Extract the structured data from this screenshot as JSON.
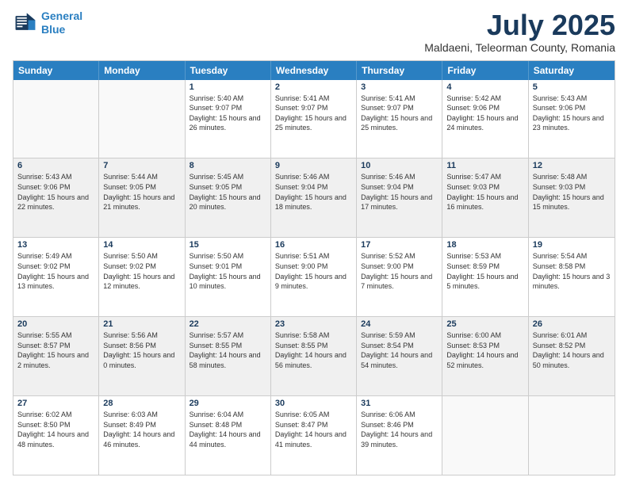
{
  "header": {
    "logo_line1": "General",
    "logo_line2": "Blue",
    "title": "July 2025",
    "subtitle": "Maldaeni, Teleorman County, Romania"
  },
  "days_of_week": [
    "Sunday",
    "Monday",
    "Tuesday",
    "Wednesday",
    "Thursday",
    "Friday",
    "Saturday"
  ],
  "weeks": [
    [
      {
        "day": "",
        "empty": true
      },
      {
        "day": "",
        "empty": true
      },
      {
        "day": "1",
        "sunrise": "5:40 AM",
        "sunset": "9:07 PM",
        "daylight": "15 hours and 26 minutes."
      },
      {
        "day": "2",
        "sunrise": "5:41 AM",
        "sunset": "9:07 PM",
        "daylight": "15 hours and 25 minutes."
      },
      {
        "day": "3",
        "sunrise": "5:41 AM",
        "sunset": "9:07 PM",
        "daylight": "15 hours and 25 minutes."
      },
      {
        "day": "4",
        "sunrise": "5:42 AM",
        "sunset": "9:06 PM",
        "daylight": "15 hours and 24 minutes."
      },
      {
        "day": "5",
        "sunrise": "5:43 AM",
        "sunset": "9:06 PM",
        "daylight": "15 hours and 23 minutes."
      }
    ],
    [
      {
        "day": "6",
        "sunrise": "5:43 AM",
        "sunset": "9:06 PM",
        "daylight": "15 hours and 22 minutes.",
        "shaded": true
      },
      {
        "day": "7",
        "sunrise": "5:44 AM",
        "sunset": "9:05 PM",
        "daylight": "15 hours and 21 minutes.",
        "shaded": true
      },
      {
        "day": "8",
        "sunrise": "5:45 AM",
        "sunset": "9:05 PM",
        "daylight": "15 hours and 20 minutes.",
        "shaded": true
      },
      {
        "day": "9",
        "sunrise": "5:46 AM",
        "sunset": "9:04 PM",
        "daylight": "15 hours and 18 minutes.",
        "shaded": true
      },
      {
        "day": "10",
        "sunrise": "5:46 AM",
        "sunset": "9:04 PM",
        "daylight": "15 hours and 17 minutes.",
        "shaded": true
      },
      {
        "day": "11",
        "sunrise": "5:47 AM",
        "sunset": "9:03 PM",
        "daylight": "15 hours and 16 minutes.",
        "shaded": true
      },
      {
        "day": "12",
        "sunrise": "5:48 AM",
        "sunset": "9:03 PM",
        "daylight": "15 hours and 15 minutes.",
        "shaded": true
      }
    ],
    [
      {
        "day": "13",
        "sunrise": "5:49 AM",
        "sunset": "9:02 PM",
        "daylight": "15 hours and 13 minutes."
      },
      {
        "day": "14",
        "sunrise": "5:50 AM",
        "sunset": "9:02 PM",
        "daylight": "15 hours and 12 minutes."
      },
      {
        "day": "15",
        "sunrise": "5:50 AM",
        "sunset": "9:01 PM",
        "daylight": "15 hours and 10 minutes."
      },
      {
        "day": "16",
        "sunrise": "5:51 AM",
        "sunset": "9:00 PM",
        "daylight": "15 hours and 9 minutes."
      },
      {
        "day": "17",
        "sunrise": "5:52 AM",
        "sunset": "9:00 PM",
        "daylight": "15 hours and 7 minutes."
      },
      {
        "day": "18",
        "sunrise": "5:53 AM",
        "sunset": "8:59 PM",
        "daylight": "15 hours and 5 minutes."
      },
      {
        "day": "19",
        "sunrise": "5:54 AM",
        "sunset": "8:58 PM",
        "daylight": "15 hours and 3 minutes."
      }
    ],
    [
      {
        "day": "20",
        "sunrise": "5:55 AM",
        "sunset": "8:57 PM",
        "daylight": "15 hours and 2 minutes.",
        "shaded": true
      },
      {
        "day": "21",
        "sunrise": "5:56 AM",
        "sunset": "8:56 PM",
        "daylight": "15 hours and 0 minutes.",
        "shaded": true
      },
      {
        "day": "22",
        "sunrise": "5:57 AM",
        "sunset": "8:55 PM",
        "daylight": "14 hours and 58 minutes.",
        "shaded": true
      },
      {
        "day": "23",
        "sunrise": "5:58 AM",
        "sunset": "8:55 PM",
        "daylight": "14 hours and 56 minutes.",
        "shaded": true
      },
      {
        "day": "24",
        "sunrise": "5:59 AM",
        "sunset": "8:54 PM",
        "daylight": "14 hours and 54 minutes.",
        "shaded": true
      },
      {
        "day": "25",
        "sunrise": "6:00 AM",
        "sunset": "8:53 PM",
        "daylight": "14 hours and 52 minutes.",
        "shaded": true
      },
      {
        "day": "26",
        "sunrise": "6:01 AM",
        "sunset": "8:52 PM",
        "daylight": "14 hours and 50 minutes.",
        "shaded": true
      }
    ],
    [
      {
        "day": "27",
        "sunrise": "6:02 AM",
        "sunset": "8:50 PM",
        "daylight": "14 hours and 48 minutes."
      },
      {
        "day": "28",
        "sunrise": "6:03 AM",
        "sunset": "8:49 PM",
        "daylight": "14 hours and 46 minutes."
      },
      {
        "day": "29",
        "sunrise": "6:04 AM",
        "sunset": "8:48 PM",
        "daylight": "14 hours and 44 minutes."
      },
      {
        "day": "30",
        "sunrise": "6:05 AM",
        "sunset": "8:47 PM",
        "daylight": "14 hours and 41 minutes."
      },
      {
        "day": "31",
        "sunrise": "6:06 AM",
        "sunset": "8:46 PM",
        "daylight": "14 hours and 39 minutes."
      },
      {
        "day": "",
        "empty": true
      },
      {
        "day": "",
        "empty": true
      }
    ]
  ],
  "colors": {
    "header_bg": "#2a7fc1",
    "title_color": "#1a3a5c",
    "shaded_bg": "#f0f0f0",
    "empty_bg": "#f9f9f9"
  }
}
